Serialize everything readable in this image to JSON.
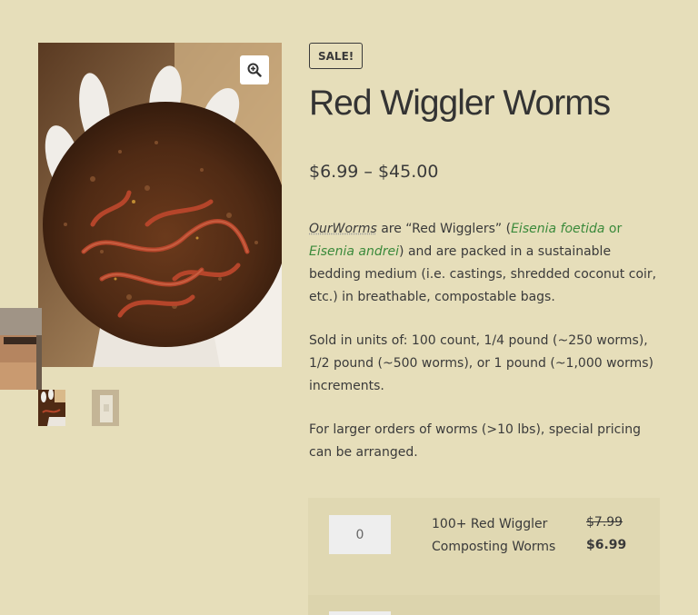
{
  "gallery": {
    "zoom_icon": "zoom-in-icon",
    "thumbnails": [
      "worm-photo-thumbnail",
      "bag-photo-thumbnail"
    ]
  },
  "product": {
    "badge": "SALE!",
    "title": "Red Wiggler Worms",
    "price_range": "$6.99 – $45.00",
    "description": {
      "brand": "OurWorms",
      "p1_a": " are “Red Wigglers” (",
      "species_1": "Eisenia foetida",
      "or": " or ",
      "species_2": "Eisenia andrei",
      "p1_b": ") and are packed in a sustainable bedding medium (i.e. castings, shredded coconut coir, etc.) in breathable, compostable bags.",
      "p2": "Sold in units of: 100 count, 1/4 pound (~250 worms), 1/2 pound (~500 worms), or 1 pound (~1,000 worms) increments.",
      "p3": "For larger orders of worms (>10 lbs), special pricing  can be arranged."
    }
  },
  "variations": [
    {
      "quantity": "0",
      "name": "100+ Red Wiggler Composting Worms",
      "regular_price": "$7.99",
      "sale_price": "$6.99"
    }
  ],
  "colors": {
    "background": "#e6deba",
    "link_green": "#3b8a3b",
    "text": "#3a3a3a"
  }
}
